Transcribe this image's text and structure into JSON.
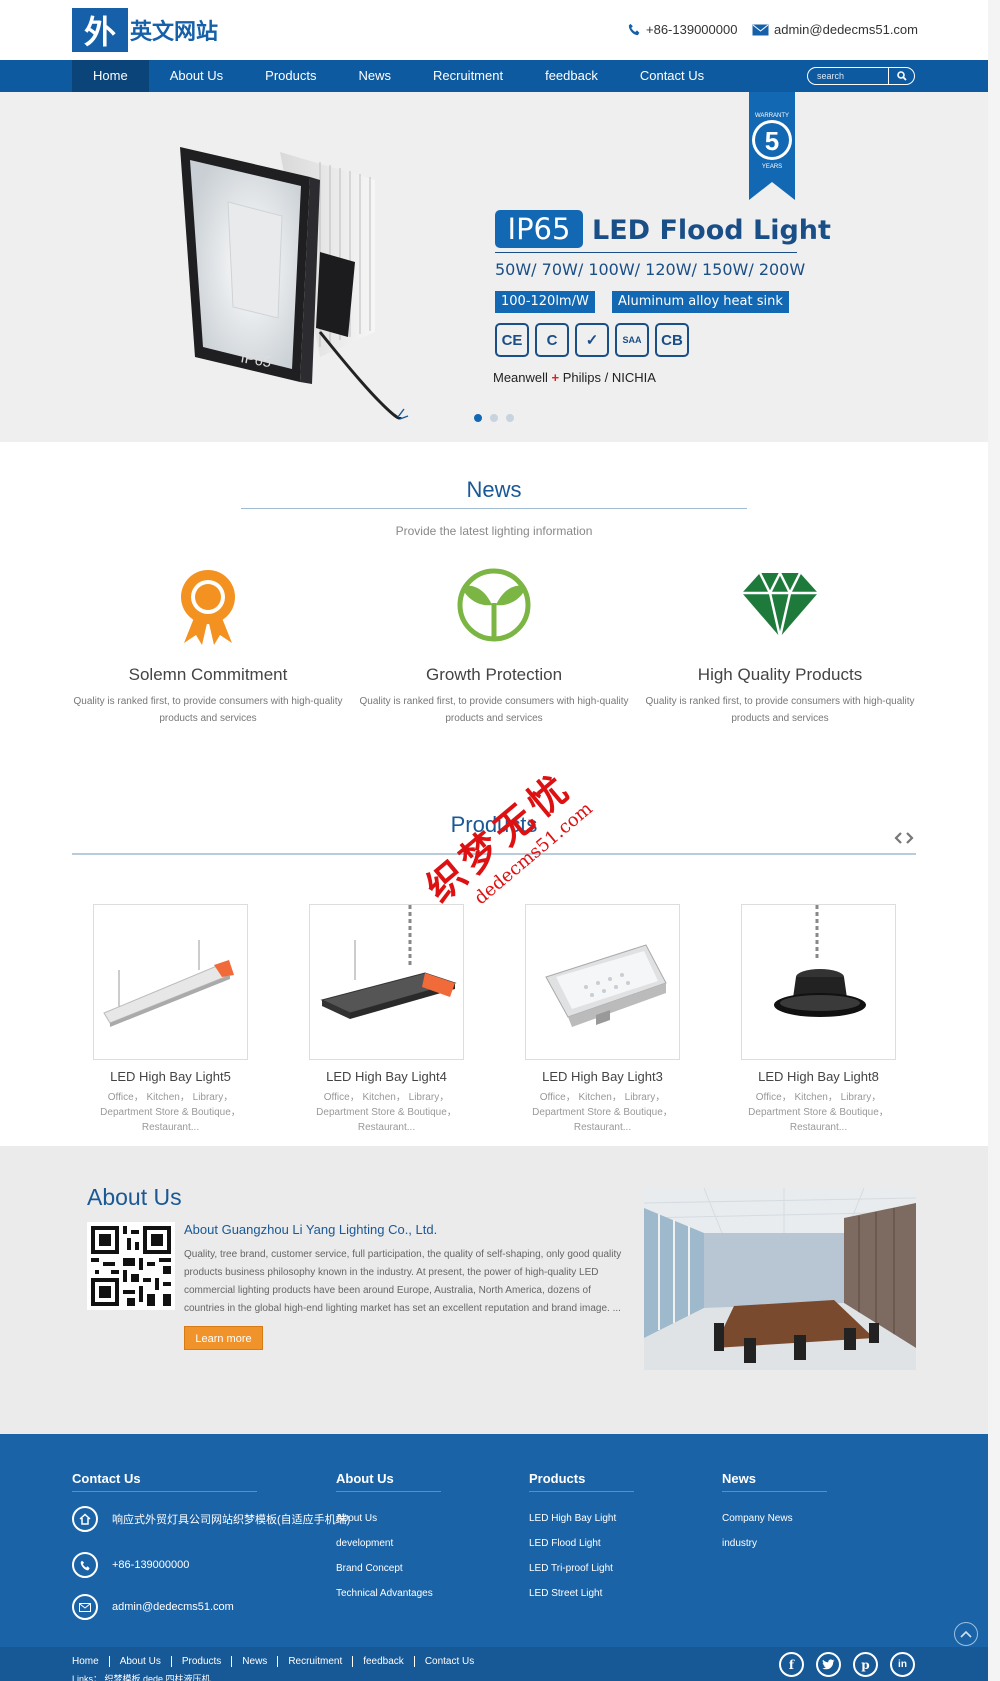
{
  "header": {
    "logo_mark": "外",
    "logo_text": "英文网站",
    "phone": "+86-139000000",
    "email": "admin@dedecms51.com"
  },
  "nav": {
    "items": [
      "Home",
      "About Us",
      "Products",
      "News",
      "Recruitment",
      "feedback",
      "Contact Us"
    ],
    "active": "Home",
    "search_placeholder": "search"
  },
  "banner": {
    "ip_badge": "IP65",
    "title": "LED Flood Light",
    "watts": "50W/ 70W/ 100W/ 120W/ 150W/ 200W",
    "spec1": "100-120lm/W",
    "spec2": "Aluminum alloy heat sink",
    "certs": [
      "CE",
      "C",
      "✓",
      "SAA",
      "CB"
    ],
    "drivers_a": "Meanwell ",
    "drivers_plus": "+",
    "drivers_b": " Philips / NICHIA",
    "lamp_label": "IP65",
    "warranty_top": "WARRANTY",
    "warranty_num": "5",
    "warranty_bottom": "YEARS",
    "slides": 3,
    "active_slide": 1
  },
  "news": {
    "title": "News",
    "subtitle": "Provide the latest lighting information",
    "features": [
      {
        "name": "Solemn Commitment",
        "icon": "award-ribbon-icon",
        "desc": "Quality is ranked first, to provide consumers with high-quality products and services"
      },
      {
        "name": "Growth Protection",
        "icon": "sprout-icon",
        "desc": "Quality is ranked first, to provide consumers with high-quality products and services"
      },
      {
        "name": "High Quality Products",
        "icon": "diamond-icon",
        "desc": "Quality is ranked first, to provide consumers with high-quality products and services"
      }
    ]
  },
  "products": {
    "title": "Products",
    "items": [
      {
        "name": "LED High Bay Light5",
        "desc": "Office， Kitchen， Library，Department Store & Boutique，Restaurant..."
      },
      {
        "name": "LED High Bay Light4",
        "desc": "Office， Kitchen， Library，Department Store & Boutique，Restaurant..."
      },
      {
        "name": "LED High Bay Light3",
        "desc": "Office， Kitchen， Library，Department Store & Boutique，Restaurant..."
      },
      {
        "name": "LED High Bay Light8",
        "desc": "Office， Kitchen， Library，Department Store & Boutique，Restaurant..."
      }
    ]
  },
  "watermark": {
    "cn": "织梦无忧",
    "url": "dedecms51.com"
  },
  "about": {
    "title": "About Us",
    "subtitle": "About Guangzhou Li Yang Lighting Co., Ltd.",
    "text": "Quality, tree brand, customer service, full participation, the quality of self-shaping, only good quality products business philosophy known in the industry. At present, the power of high-quality LED commercial lighting products have been around Europe, Australia, North America, dozens of countries in the global high-end lighting market has set an excellent reputation and brand image. ...",
    "button": "Learn more"
  },
  "footer": {
    "contact_title": "Contact Us",
    "contact_company": "响应式外贸灯具公司网站织梦模板(自适应手机端)",
    "contact_phone": "+86-139000000",
    "contact_email": "admin@dedecms51.com",
    "about_title": "About Us",
    "about_links": [
      "About Us",
      "development",
      "Brand Concept",
      "Technical Advantages"
    ],
    "products_title": "Products",
    "products_links": [
      "LED High Bay Light",
      "LED Flood Light",
      "LED Tri-proof Light",
      "LED Street Light"
    ],
    "news_title": "News",
    "news_links": [
      "Company News",
      "industry"
    ],
    "bottom_nav": [
      "Home",
      "About Us",
      "Products",
      "News",
      "Recruitment",
      "feedback",
      "Contact Us"
    ],
    "links_line": "Links：   织梦模板    dede    四柱液压机",
    "social": [
      "facebook-icon",
      "twitter-icon",
      "pinterest-icon",
      "linkedin-icon"
    ]
  },
  "colors": {
    "brand_blue": "#0e5aa0",
    "footer_blue": "#1b63a7",
    "accent_orange": "#f0932b"
  }
}
